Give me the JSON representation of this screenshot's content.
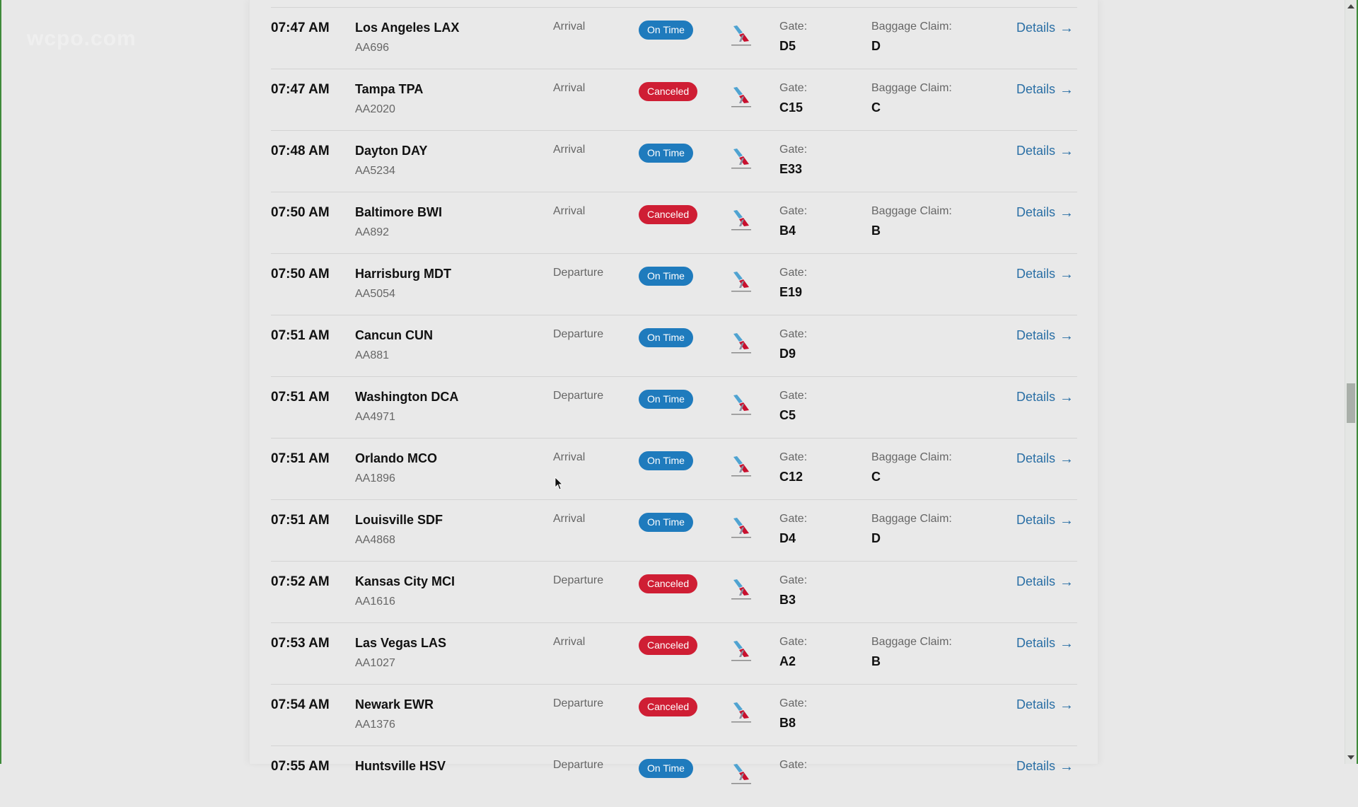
{
  "watermark": "wcpo.com",
  "labels": {
    "gate": "Gate:",
    "baggage": "Baggage Claim:",
    "details": "Details",
    "details_arrow": "→"
  },
  "colors": {
    "on_time": "#1f7bbd",
    "canceled": "#cf1e34",
    "link": "#2a6fa5"
  },
  "airline_logo": "american-airlines-logo",
  "flights": [
    {
      "time": "07:47 AM",
      "destination": "Los Angeles LAX",
      "flight": "AA696",
      "type": "Arrival",
      "status": "On Time",
      "gate": "D5",
      "baggage": "D"
    },
    {
      "time": "07:47 AM",
      "destination": "Tampa TPA",
      "flight": "AA2020",
      "type": "Arrival",
      "status": "Canceled",
      "gate": "C15",
      "baggage": "C"
    },
    {
      "time": "07:48 AM",
      "destination": "Dayton DAY",
      "flight": "AA5234",
      "type": "Arrival",
      "status": "On Time",
      "gate": "E33",
      "baggage": null
    },
    {
      "time": "07:50 AM",
      "destination": "Baltimore BWI",
      "flight": "AA892",
      "type": "Arrival",
      "status": "Canceled",
      "gate": "B4",
      "baggage": "B"
    },
    {
      "time": "07:50 AM",
      "destination": "Harrisburg MDT",
      "flight": "AA5054",
      "type": "Departure",
      "status": "On Time",
      "gate": "E19",
      "baggage": null
    },
    {
      "time": "07:51 AM",
      "destination": "Cancun CUN",
      "flight": "AA881",
      "type": "Departure",
      "status": "On Time",
      "gate": "D9",
      "baggage": null
    },
    {
      "time": "07:51 AM",
      "destination": "Washington DCA",
      "flight": "AA4971",
      "type": "Departure",
      "status": "On Time",
      "gate": "C5",
      "baggage": null
    },
    {
      "time": "07:51 AM",
      "destination": "Orlando MCO",
      "flight": "AA1896",
      "type": "Arrival",
      "status": "On Time",
      "gate": "C12",
      "baggage": "C"
    },
    {
      "time": "07:51 AM",
      "destination": "Louisville SDF",
      "flight": "AA4868",
      "type": "Arrival",
      "status": "On Time",
      "gate": "D4",
      "baggage": "D"
    },
    {
      "time": "07:52 AM",
      "destination": "Kansas City MCI",
      "flight": "AA1616",
      "type": "Departure",
      "status": "Canceled",
      "gate": "B3",
      "baggage": null
    },
    {
      "time": "07:53 AM",
      "destination": "Las Vegas LAS",
      "flight": "AA1027",
      "type": "Arrival",
      "status": "Canceled",
      "gate": "A2",
      "baggage": "B"
    },
    {
      "time": "07:54 AM",
      "destination": "Newark EWR",
      "flight": "AA1376",
      "type": "Departure",
      "status": "Canceled",
      "gate": "B8",
      "baggage": null
    },
    {
      "time": "07:55 AM",
      "destination": "Huntsville HSV",
      "flight": "",
      "type": "Departure",
      "status": "On Time",
      "gate": "",
      "baggage": null
    }
  ],
  "scrollbar": {
    "position_fraction": 0.53
  }
}
